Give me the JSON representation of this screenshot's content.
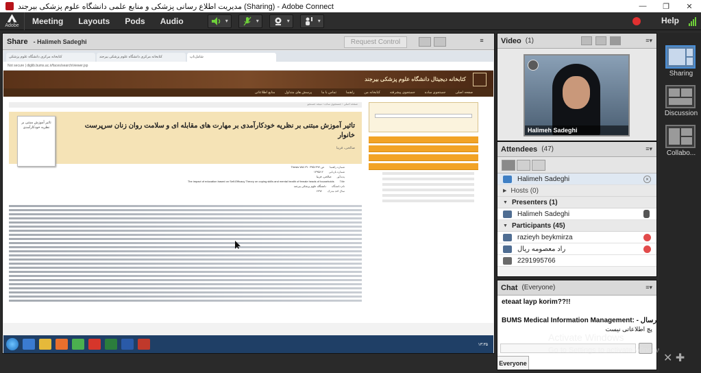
{
  "window": {
    "title": "مدیریت اطلاع رسانی پزشکی و منابع علمی دانشگاه علوم پزشکی بیرجند (Sharing) - Adobe Connect",
    "min": "—",
    "max": "❐",
    "close": "✕"
  },
  "menubar": {
    "logo_text": "Adobe",
    "items": [
      "Meeting",
      "Layouts",
      "Pods",
      "Audio"
    ],
    "help": "Help",
    "dropdown_glyph": "▾"
  },
  "share": {
    "title": "Share",
    "presenter": "- Halimeh Sadeghi",
    "request_control": "Request Control"
  },
  "shared_screen": {
    "tabs": [
      "کتابخانه مرکزی دانشگاه علوم پزشکی",
      "کتابخانه مرکزی دانشگاه علوم پزشکی بیرجند",
      "شامل‌ناپ"
    ],
    "address": "Not secure | diglib.bums.ac.ir/faces/search/viewer.jsp",
    "banner": "کتابخانه دیجیتال دانشگاه علوم پزشکی بیرجند",
    "nav": [
      "صفحه اصلی",
      "جستجوی ساده",
      "جستجوی پیشرفته",
      "کتابخانه من",
      "راهنما",
      "تماس با ما",
      "پرسش های متداول",
      "منابع اطلاعاتی"
    ],
    "breadcrumb": "صفحه اصلی › جستجوی ساده › نتیجه جستجو",
    "thumb_text": "تاثیر آموزش مبتنی بر نظریه خودکارآمدی",
    "article_title": "تاثیر آموزش مبتنی بر نظریه خودکارآمدی بر مهارت های مقابله ای و سلامت روان زنان سرپرست خانوار",
    "authors": "صالحی، فریبا",
    "meta": [
      {
        "k": "شماره راهنما",
        "v": "Thesis WA ۲۹۰ ص ۳۹۵۱۳۹۶"
      },
      {
        "k": "شماره بازیابی",
        "v": "۱۳۹۵/۱۲"
      },
      {
        "k": "پدیدآور",
        "v": "صالحی، فریبا"
      },
      {
        "k": "Title",
        "v": "The impact of education based on Self-Efficacy Theory on coping skills and mental health of female heads of households"
      },
      {
        "k": "نام دانشگاه",
        "v": "دانشگاه علوم پزشکی بیرجند"
      },
      {
        "k": "سال اخذ مدرک",
        "v": "۱۳۹۶"
      }
    ],
    "taskbar_clock": "۱۳:۳۵"
  },
  "video": {
    "title": "Video",
    "count": "(1)",
    "name": "Halimeh Sadeghi"
  },
  "attendees": {
    "title": "Attendees",
    "count": "(47)",
    "host_self": "Halimeh Sadeghi",
    "hosts_label": "Hosts (0)",
    "presenters_label": "Presenters (1)",
    "presenter_name": "Halimeh Sadeghi",
    "participants_label": "Participants (45)",
    "participants": [
      "razieyh beykmirza",
      "راد معصومه ریال",
      "2291995766"
    ],
    "remove_glyph": "×"
  },
  "chat": {
    "title": "Chat",
    "scope": "(Everyone)",
    "messages": [
      "eteaat layp korim??!!",
      "BUMS Medical  Information Management: - نمایه ارسال",
      "پچ اطلاعاتی نیست"
    ],
    "tab": "Everyone"
  },
  "watermark": {
    "line1": "Activate Windows",
    "line2": "Go to Settings to activate Windows."
  },
  "layouts": {
    "items": [
      "Sharing",
      "Discussion",
      "Collabo..."
    ]
  },
  "colors": {
    "accent": "#4a8fd8",
    "record": "#e03030",
    "banner": "#5a3218",
    "orange": "#f2a326"
  }
}
